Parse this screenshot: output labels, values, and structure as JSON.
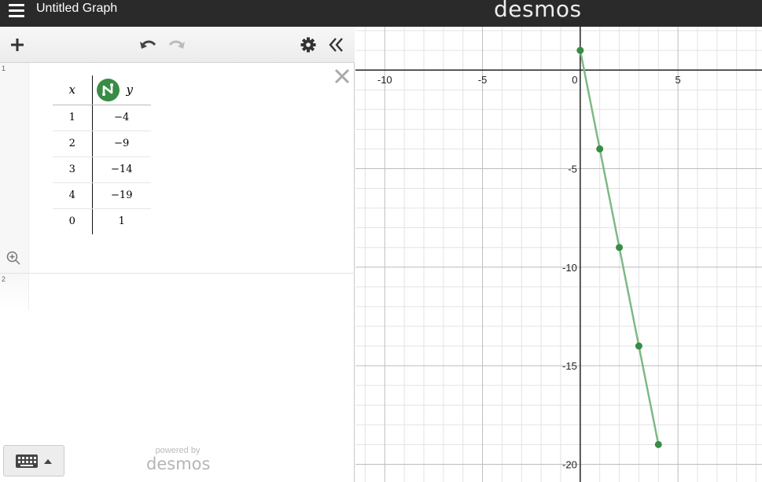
{
  "header": {
    "menu_icon": "hamburger-menu-icon",
    "title": "Untitled Graph",
    "brand": "desmos"
  },
  "toolbar": {
    "add_icon": "plus-icon",
    "undo_icon": "undo-icon",
    "redo_icon": "redo-icon",
    "settings_icon": "gear-icon",
    "collapse_icon": "double-chevron-left-icon"
  },
  "expressions": [
    {
      "number": "1",
      "type": "table",
      "columns": [
        "x",
        "y"
      ],
      "rows": [
        [
          "1",
          "−4"
        ],
        [
          "2",
          "−9"
        ],
        [
          "3",
          "−14"
        ],
        [
          "4",
          "−19"
        ],
        [
          "0",
          "1"
        ]
      ],
      "series_color": "#388c46"
    },
    {
      "number": "2",
      "type": "empty"
    }
  ],
  "footer": {
    "keyboard_icon": "keyboard-icon",
    "powered_by": "powered by",
    "powered_logo": "desmos"
  },
  "graph": {
    "x_tick_labels": [
      "-10",
      "-5",
      "0",
      "5"
    ],
    "y_tick_labels": [
      "-5",
      "-10",
      "-15",
      "-20"
    ],
    "grid": true,
    "point_color": "#388c46",
    "line_color": "#7fb985"
  },
  "chart_data": {
    "type": "scatter",
    "title": "",
    "xlabel": "",
    "ylabel": "",
    "grid": true,
    "xlim": [
      -11.5,
      9.3
    ],
    "ylim": [
      -20.9,
      2.2
    ],
    "series": [
      {
        "points": [
          [
            1,
            -4
          ],
          [
            2,
            -9
          ],
          [
            3,
            -14
          ],
          [
            4,
            -19
          ],
          [
            0,
            1
          ]
        ],
        "connected": true,
        "color": "#388c46"
      }
    ]
  }
}
